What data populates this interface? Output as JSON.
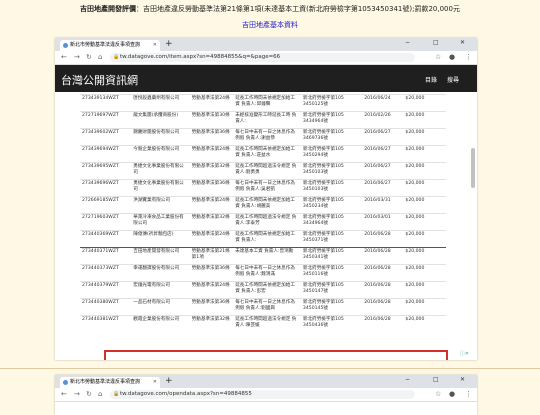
{
  "caption": {
    "label": "吉田地產開發評價",
    "text": "：吉田地產違反勞動基準法第21條第1項(未達基本工資(新北府勞檢字第1053450341號);罰款20,000元",
    "link": "吉田地產基本資料"
  },
  "browser1": {
    "tab_title": "新北市勞動基準法違反事項查詢",
    "url": "tw.datagove.com/item.aspx?sn=49884855&q=&page=66",
    "site_title": "台灣公開資訊網",
    "nav_home": "目錄",
    "nav_search": "搜尋"
  },
  "browser2": {
    "tab_title": "新北市勞動基準法違反事項查詢",
    "url": "tw.datagove.com/opendata.aspx?sn=49884855"
  },
  "rows": [
    [
      "273439134WZT",
      "匯悅殺蟲藥劑有限公司",
      "勞動基準法第24條",
      "延長工作時間未依規定加給工資 負責人:邱鐘聲",
      "新北府勞檢字第105 3450125號",
      "2016/06/24",
      "$20,000"
    ],
    [
      "272719697WZT",
      "龍文集團(承攬商股份)",
      "勞動基準法第30條",
      "未經核准變形工時延長工時 負責人:",
      "新北府勞檢字第105 3434964號",
      "2016/02/26",
      "$20,000"
    ],
    [
      "273439602WZT",
      "錦慶財團股份有限公司",
      "勞動基準法第36條",
      "每七日中未有一日之休息作為例假 負責人:謝益恭",
      "新北府勞檢字第105 3469736號",
      "2016/06/27",
      "$20,000"
    ],
    [
      "273439694WZT",
      "今競企業股份有限公司",
      "勞動基準法第24條",
      "延長工作時間未依規定加給工資 負責人:莊益水",
      "新北府勞檢字第105 3450294號",
      "2016/06/27",
      "$20,000"
    ],
    [
      "273439695WZT",
      "勇捷文化事業股份有限公司",
      "勞動基準法第32條",
      "延長工作時間超過法令規定 負責人:劉勇勇",
      "新北府勞檢字第105 3450103號",
      "2016/06/27",
      "$20,000"
    ],
    [
      "273439696WZT",
      "勇捷文化事業股份有限公司",
      "勞動基準法第36條",
      "每七日中未有一日之休息作為例假 負責人:吳君凱",
      "新北府勞檢字第105 3450103號",
      "2016/06/27",
      "$20,000"
    ],
    [
      "272669185WZT",
      "洪湖實業有限公司",
      "勞動基準法第24條",
      "延長工作時間未依規定加給工資 負責人:胡麗美",
      "新北府勞檢字第105 3450234號",
      "2016/03/31",
      "$20,000"
    ],
    [
      "272719603WZT",
      "華萊冷凍食品工業股份有限公司",
      "勞動基準法第32條",
      "延長工作時間超過法令規定 負責人:李泰芳",
      "新北府勞檢字第105 3434964號",
      "2016/03/01",
      "$20,000"
    ],
    [
      "273440369WZT",
      "陳億傳(祈昇麵包店)",
      "勞動基準法第24條",
      "延長工作時間未依規定加給工資 負責人:",
      "新北府勞檢字第105 3450371號",
      "2016/06/28",
      "$20,000"
    ],
    [
      "273440371WZT",
      "吉田地產開發有限公司",
      "勞動基準法第21條第1項",
      "未達基本工資 負責人:曾鴻勳",
      "新北府勞檢字第105 3450341號",
      "2016/06/28",
      "$20,000"
    ],
    [
      "273440373WZT",
      "幸運翻譯股份有限公司",
      "勞動基準法第36條",
      "每七日中未有一日之休息作為例假 負責人:魏鴻滿",
      "新北府勞檢字第105 3450116號",
      "2016/06/28",
      "$20,000"
    ],
    [
      "273440379WZT",
      "宏鐘光電有限公司",
      "勞動基準法第24條",
      "延長工作時間未依規定加給工資 負責人:彭宏",
      "新北府勞檢字第105 3450147號",
      "2016/06/28",
      "$20,000"
    ],
    [
      "273440380WZT",
      "一品石材有限公司",
      "勞動基準法第36條",
      "每七日中未有一日之休息作為例假 負責人:劉國興",
      "新北府勞檢字第105 3450145號",
      "2016/06/28",
      "$20,000"
    ],
    [
      "273440381WZT",
      "觀霞企業股份有限公司",
      "勞動基準法第32條",
      "延長工作時間超過法令規定 負責人:陳芸媛",
      "新北府勞檢字第105 3450436號",
      "2016/06/28",
      "$20,000"
    ]
  ]
}
